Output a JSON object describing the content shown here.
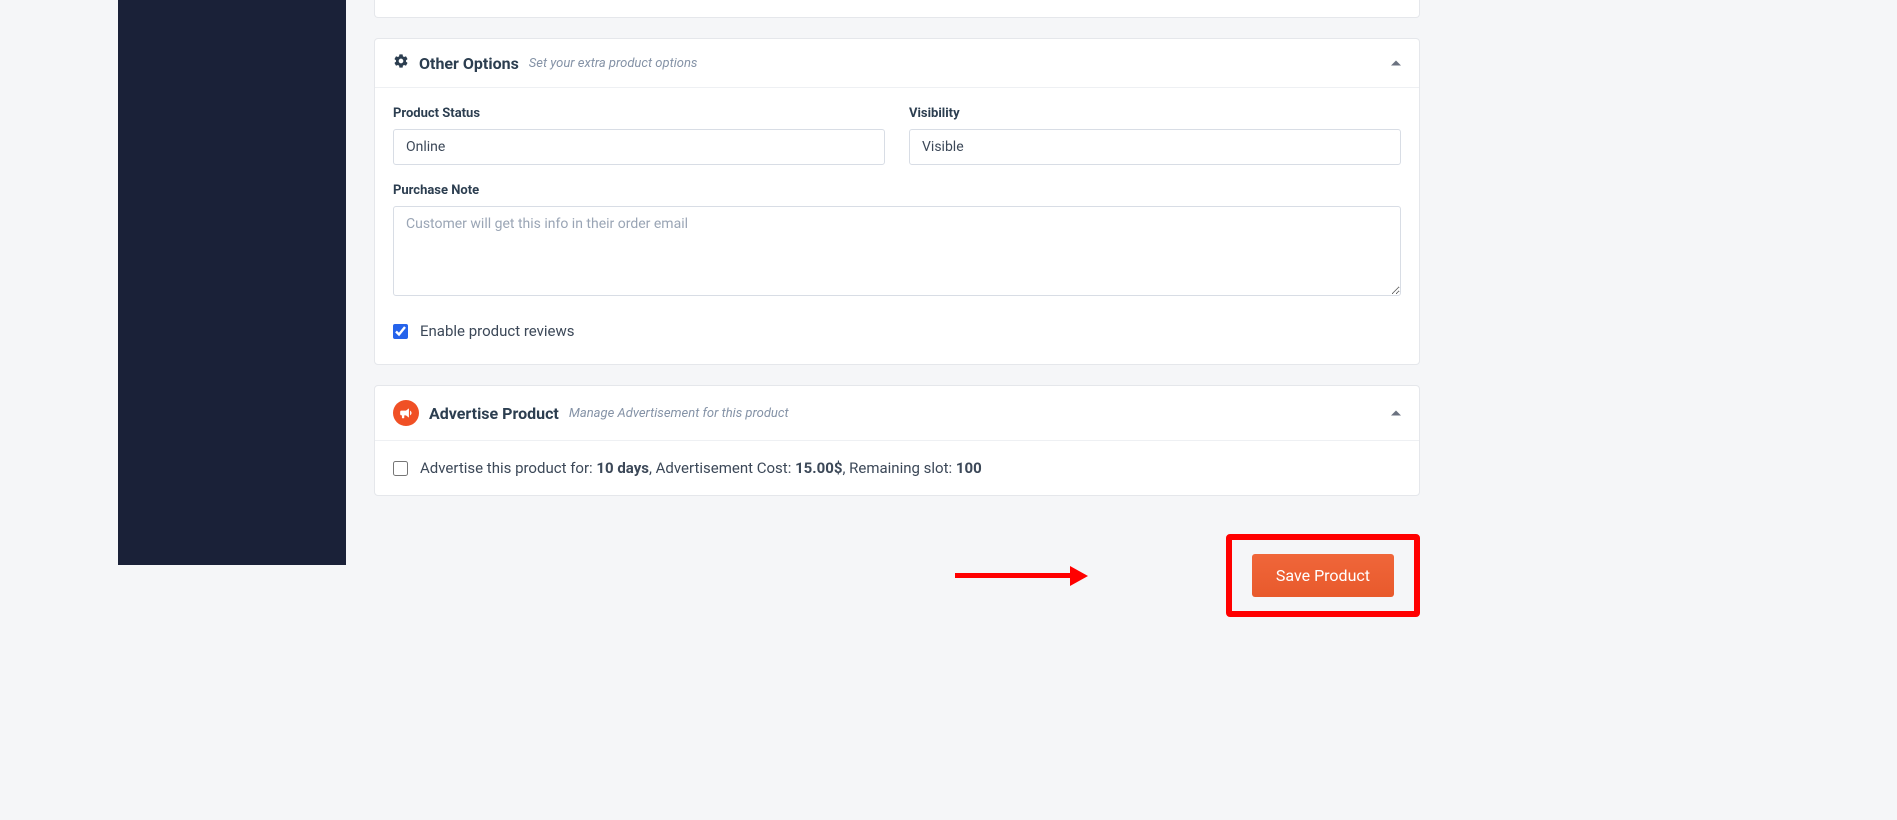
{
  "other_options": {
    "title": "Other Options",
    "subtitle": "Set your extra product options",
    "product_status": {
      "label": "Product Status",
      "value": "Online"
    },
    "visibility": {
      "label": "Visibility",
      "value": "Visible"
    },
    "purchase_note": {
      "label": "Purchase Note",
      "placeholder": "Customer will get this info in their order email",
      "value": ""
    },
    "reviews_label": "Enable product reviews"
  },
  "advertise": {
    "title": "Advertise Product",
    "subtitle": "Manage Advertisement for this product",
    "text_prefix": "Advertise this product for: ",
    "duration": "10 days",
    "cost_label": ", Advertisement Cost: ",
    "cost": "15.00$",
    "slot_label": ", Remaining slot: ",
    "slot": "100"
  },
  "actions": {
    "save_label": "Save Product"
  }
}
